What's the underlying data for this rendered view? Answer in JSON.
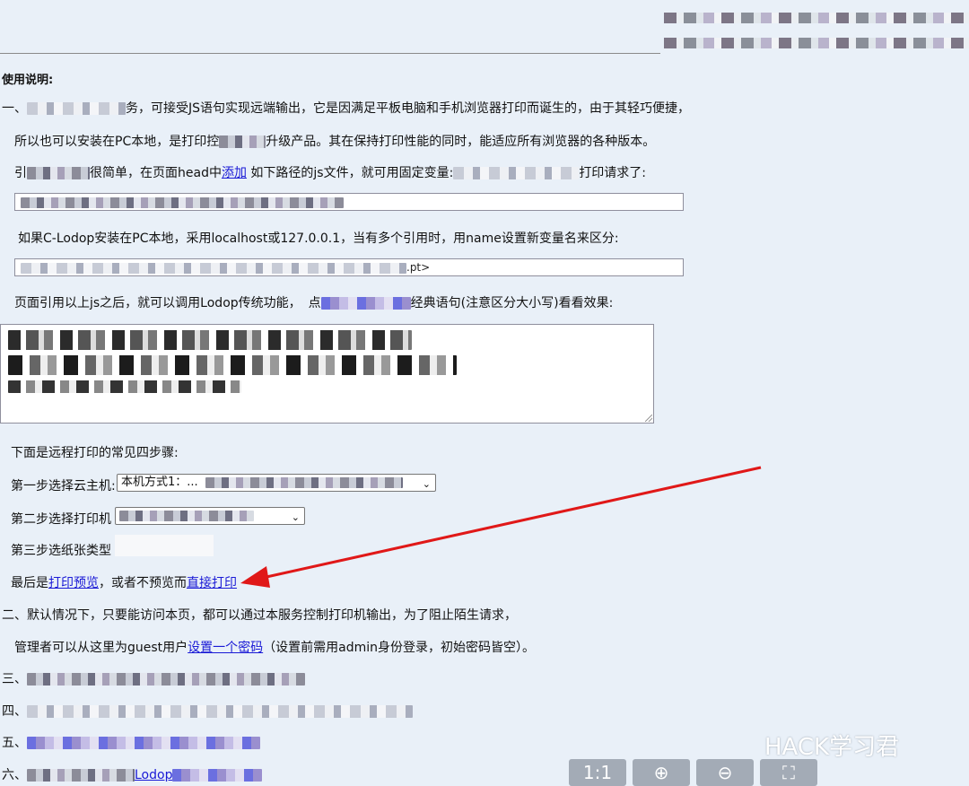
{
  "header": {
    "section_title": "使用说明:"
  },
  "para1": {
    "prefix": "一、",
    "line1": "务，可接受JS语句实现远端输出，它是因满足平板电脑和手机浏览器打印而诞生的，由于其轻巧便捷，",
    "line2a": "所以也可以安装在PC本地，是打印控",
    "line2b": "升级产品。其在保持打印性能的同时，能适应所有浏览器的各种版本。",
    "line3a": "引",
    "line3b": "很简单，在页面head中",
    "line3_link": "添加",
    "line3c": " 如下路径的js文件，就可用固定变量:",
    "line3d": "打印请求了:",
    "local_note": "如果C-Lodop安装在PC本地，采用localhost或127.0.0.1，当有多个引用时，用name设置新变量名来区分:",
    "input2_suffix": ".pt>",
    "after_ref_a": "页面引用以上js之后，就可以调用Lodop传统功能，",
    "after_ref_b": "点",
    "after_ref_c": "经典语句(注意区分大小写)看看效果:"
  },
  "steps": {
    "intro": "下面是远程打印的常见四步骤:",
    "step1_label": "第一步选择云主机:",
    "step1_value": "本机方式1：...",
    "step2_label": "第二步选择打印机",
    "step3_label": "第三步选纸张类型",
    "final_a": "最后是",
    "final_link1": "打印预览",
    "final_b": "，或者不预览而",
    "final_link2": "直接打印"
  },
  "para2": {
    "line1": "二、默认情况下，只要能访问本页，都可以通过本服务控制打印机输出，为了阻止陌生请求，",
    "line2a": "管理者可以从这里为guest用户",
    "line2_link": "设置一个密码",
    "line2b": "（设置前需用admin身份登录，初始密码皆空）。"
  },
  "list": {
    "item3": "三、",
    "item4": "四、",
    "item5": "五、",
    "item6": "六、",
    "item6_link": "Lodop"
  },
  "toolbar": {
    "actual_size": "1:1",
    "zoom_in": "⊕",
    "zoom_out": "⊖",
    "fit": "⛶"
  },
  "watermark": "HACK学习君",
  "colors": {
    "background": "#e9f0f8",
    "link": "#1a1ad6",
    "arrow": "#e01818"
  }
}
